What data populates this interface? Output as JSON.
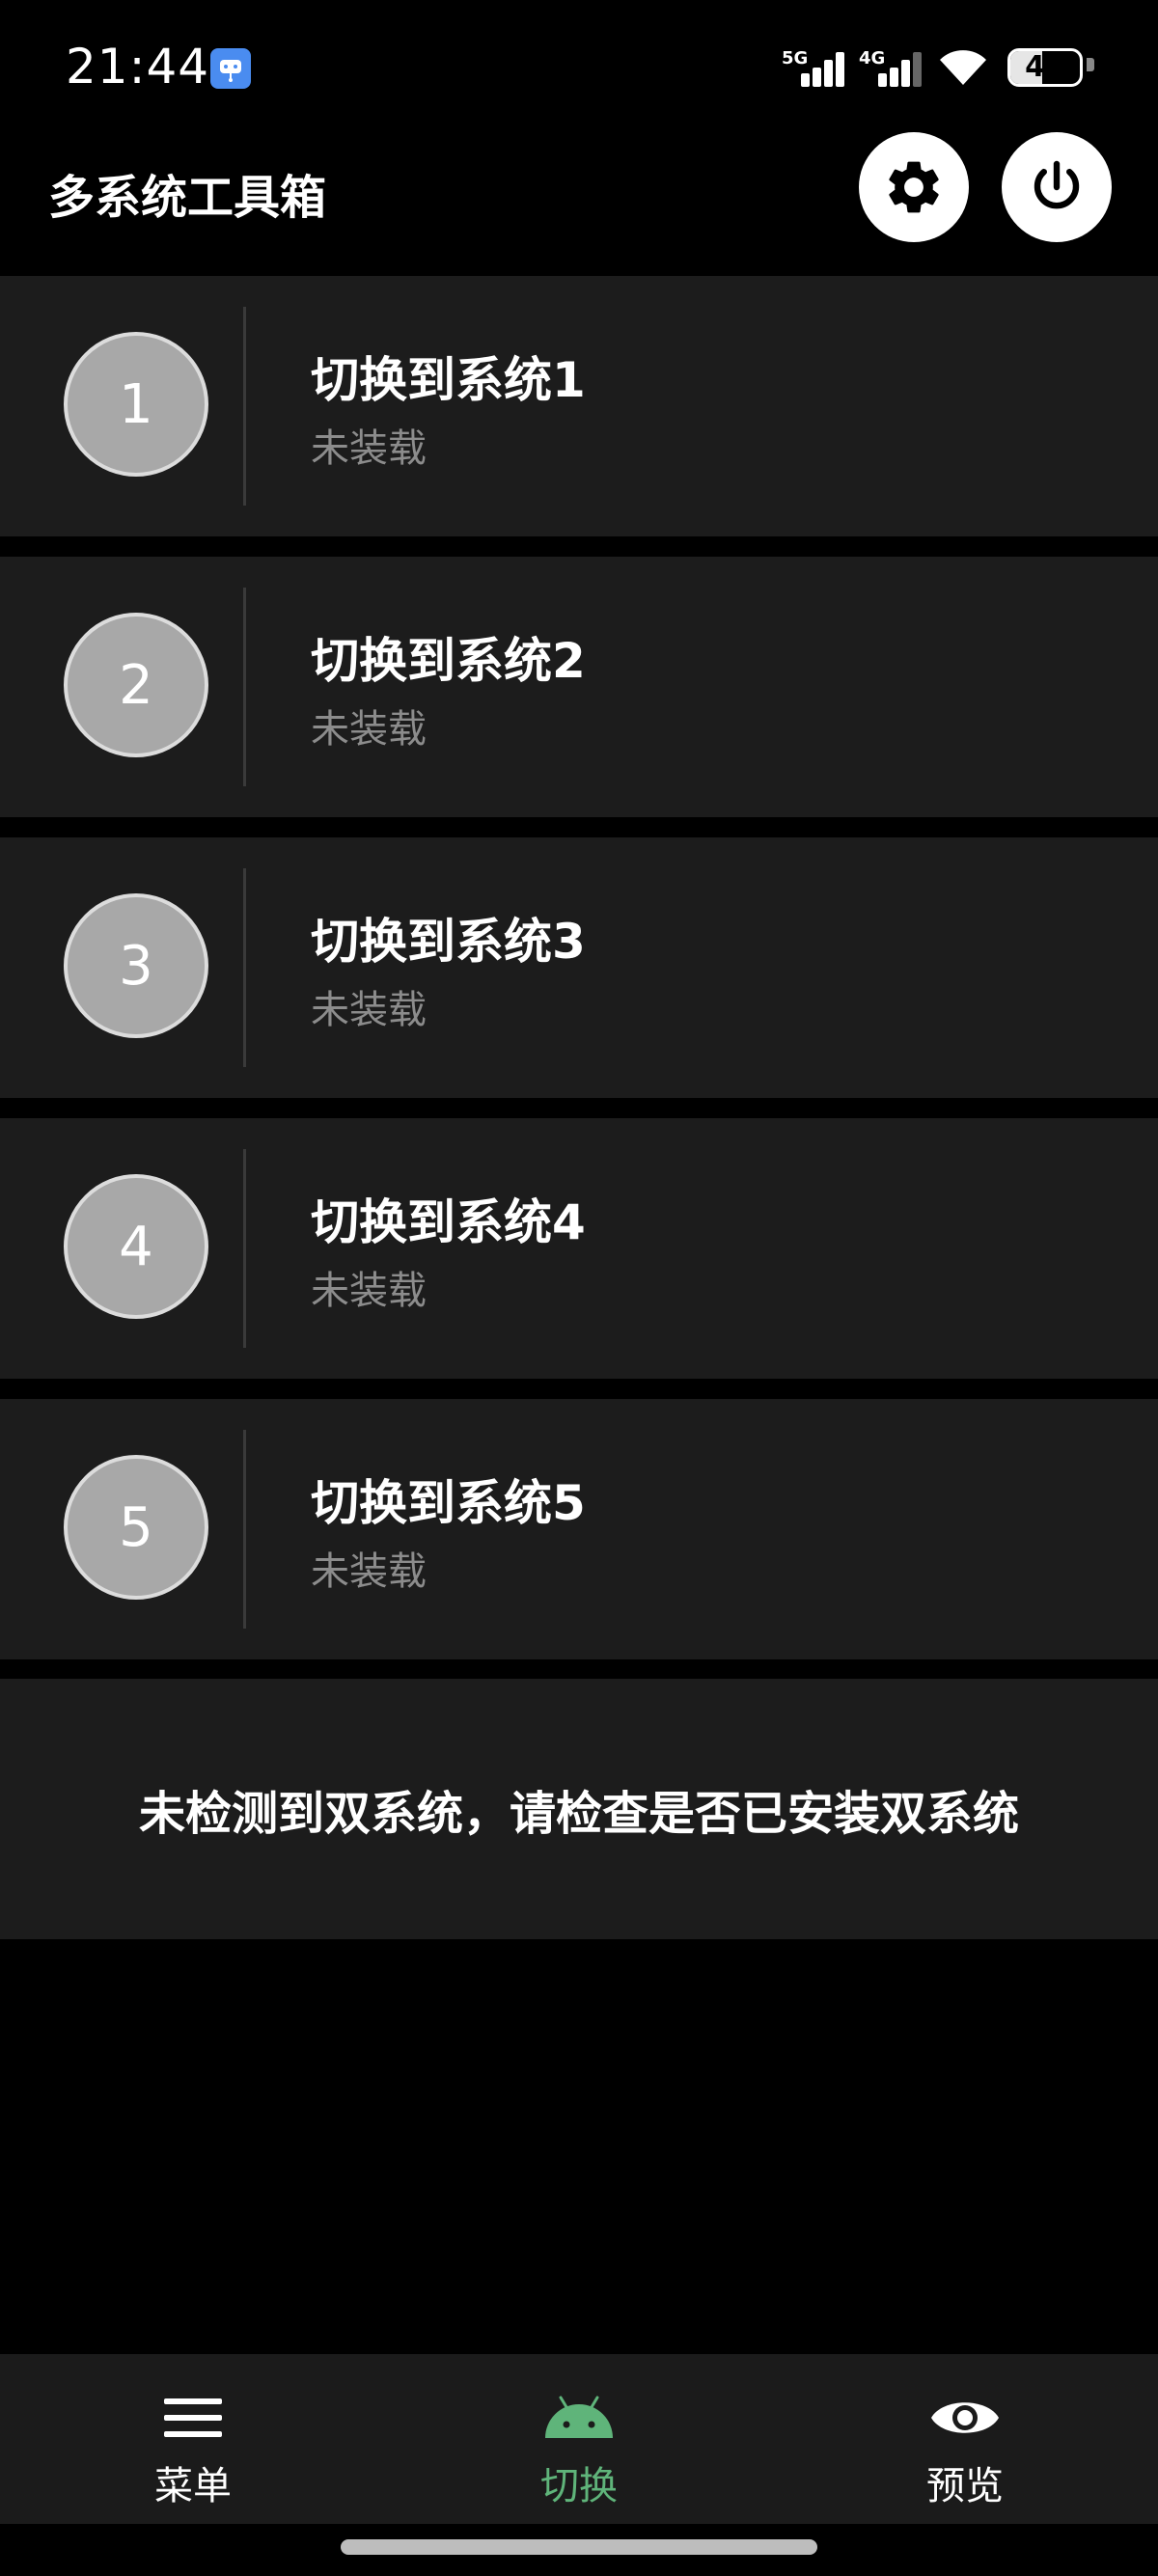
{
  "status_bar": {
    "time": "21:44",
    "network_1": "5G",
    "network_2": "4G",
    "battery": "46",
    "battery_level": 0.46
  },
  "app_bar": {
    "title": "多系统工具箱",
    "settings_icon": "gear-icon",
    "power_icon": "power-icon"
  },
  "systems": [
    {
      "number": "1",
      "title": "切换到系统1",
      "status": "未装载"
    },
    {
      "number": "2",
      "title": "切换到系统2",
      "status": "未装载"
    },
    {
      "number": "3",
      "title": "切换到系统3",
      "status": "未装载"
    },
    {
      "number": "4",
      "title": "切换到系统4",
      "status": "未装载"
    },
    {
      "number": "5",
      "title": "切换到系统5",
      "status": "未装载"
    }
  ],
  "notice": "未检测到双系统，请检查是否已安装双系统",
  "bottom_nav": {
    "items": [
      {
        "label": "菜单",
        "icon": "menu-icon",
        "active": false
      },
      {
        "label": "切换",
        "icon": "android-icon",
        "active": true
      },
      {
        "label": "预览",
        "icon": "eye-icon",
        "active": false
      }
    ]
  },
  "colors": {
    "background": "#000000",
    "card": "#1c1c1c",
    "accent": "#5fb47a",
    "circle": "#a8a8a8",
    "subtext": "#8c8c8c"
  }
}
